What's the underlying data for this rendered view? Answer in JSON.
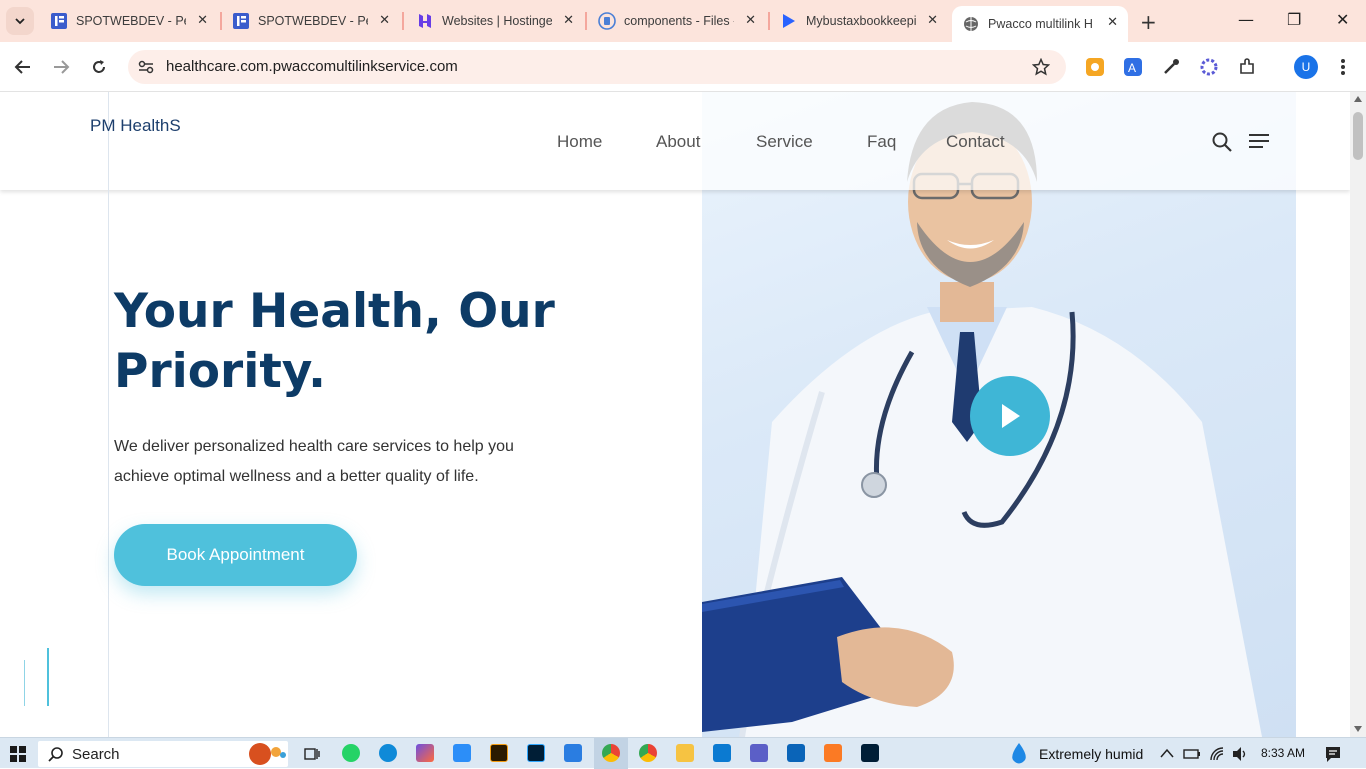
{
  "browser": {
    "tabs": [
      {
        "title": "SPOTWEBDEV - Perso",
        "icon": "elementor-icon",
        "color": "#3b5ccc"
      },
      {
        "title": "SPOTWEBDEV - Perso",
        "icon": "elementor-icon",
        "color": "#3b5ccc"
      },
      {
        "title": "Websites | Hostinger",
        "icon": "hostinger-icon",
        "color": "#673de6"
      },
      {
        "title": "components - Files -",
        "icon": "file-manager-icon",
        "color": "#4a7fd6"
      },
      {
        "title": "Mybustaxbookkeepi",
        "icon": "kinsta-icon",
        "color": "#2962ff"
      },
      {
        "title": "Pwacco multilink He",
        "icon": "globe-icon",
        "color": "#555555",
        "active": true
      }
    ],
    "url": "healthcare.com.pwaccomultilinkservice.com"
  },
  "site": {
    "logo": "PM HealthS",
    "nav": [
      "Home",
      "About",
      "Service",
      "Faq",
      "Contact"
    ],
    "headline_line1": "Your Health, Our",
    "headline_line2": "Priority.",
    "subtext": "We deliver personalized health care services to help you achieve optimal wellness and a better quality of life.",
    "cta": "Book Appointment",
    "colors": {
      "accent": "#4fc1dc",
      "heading": "#0d3b66"
    }
  },
  "taskbar": {
    "search_label": "Search",
    "weather": "Extremely humid",
    "time": "8:33 AM"
  }
}
